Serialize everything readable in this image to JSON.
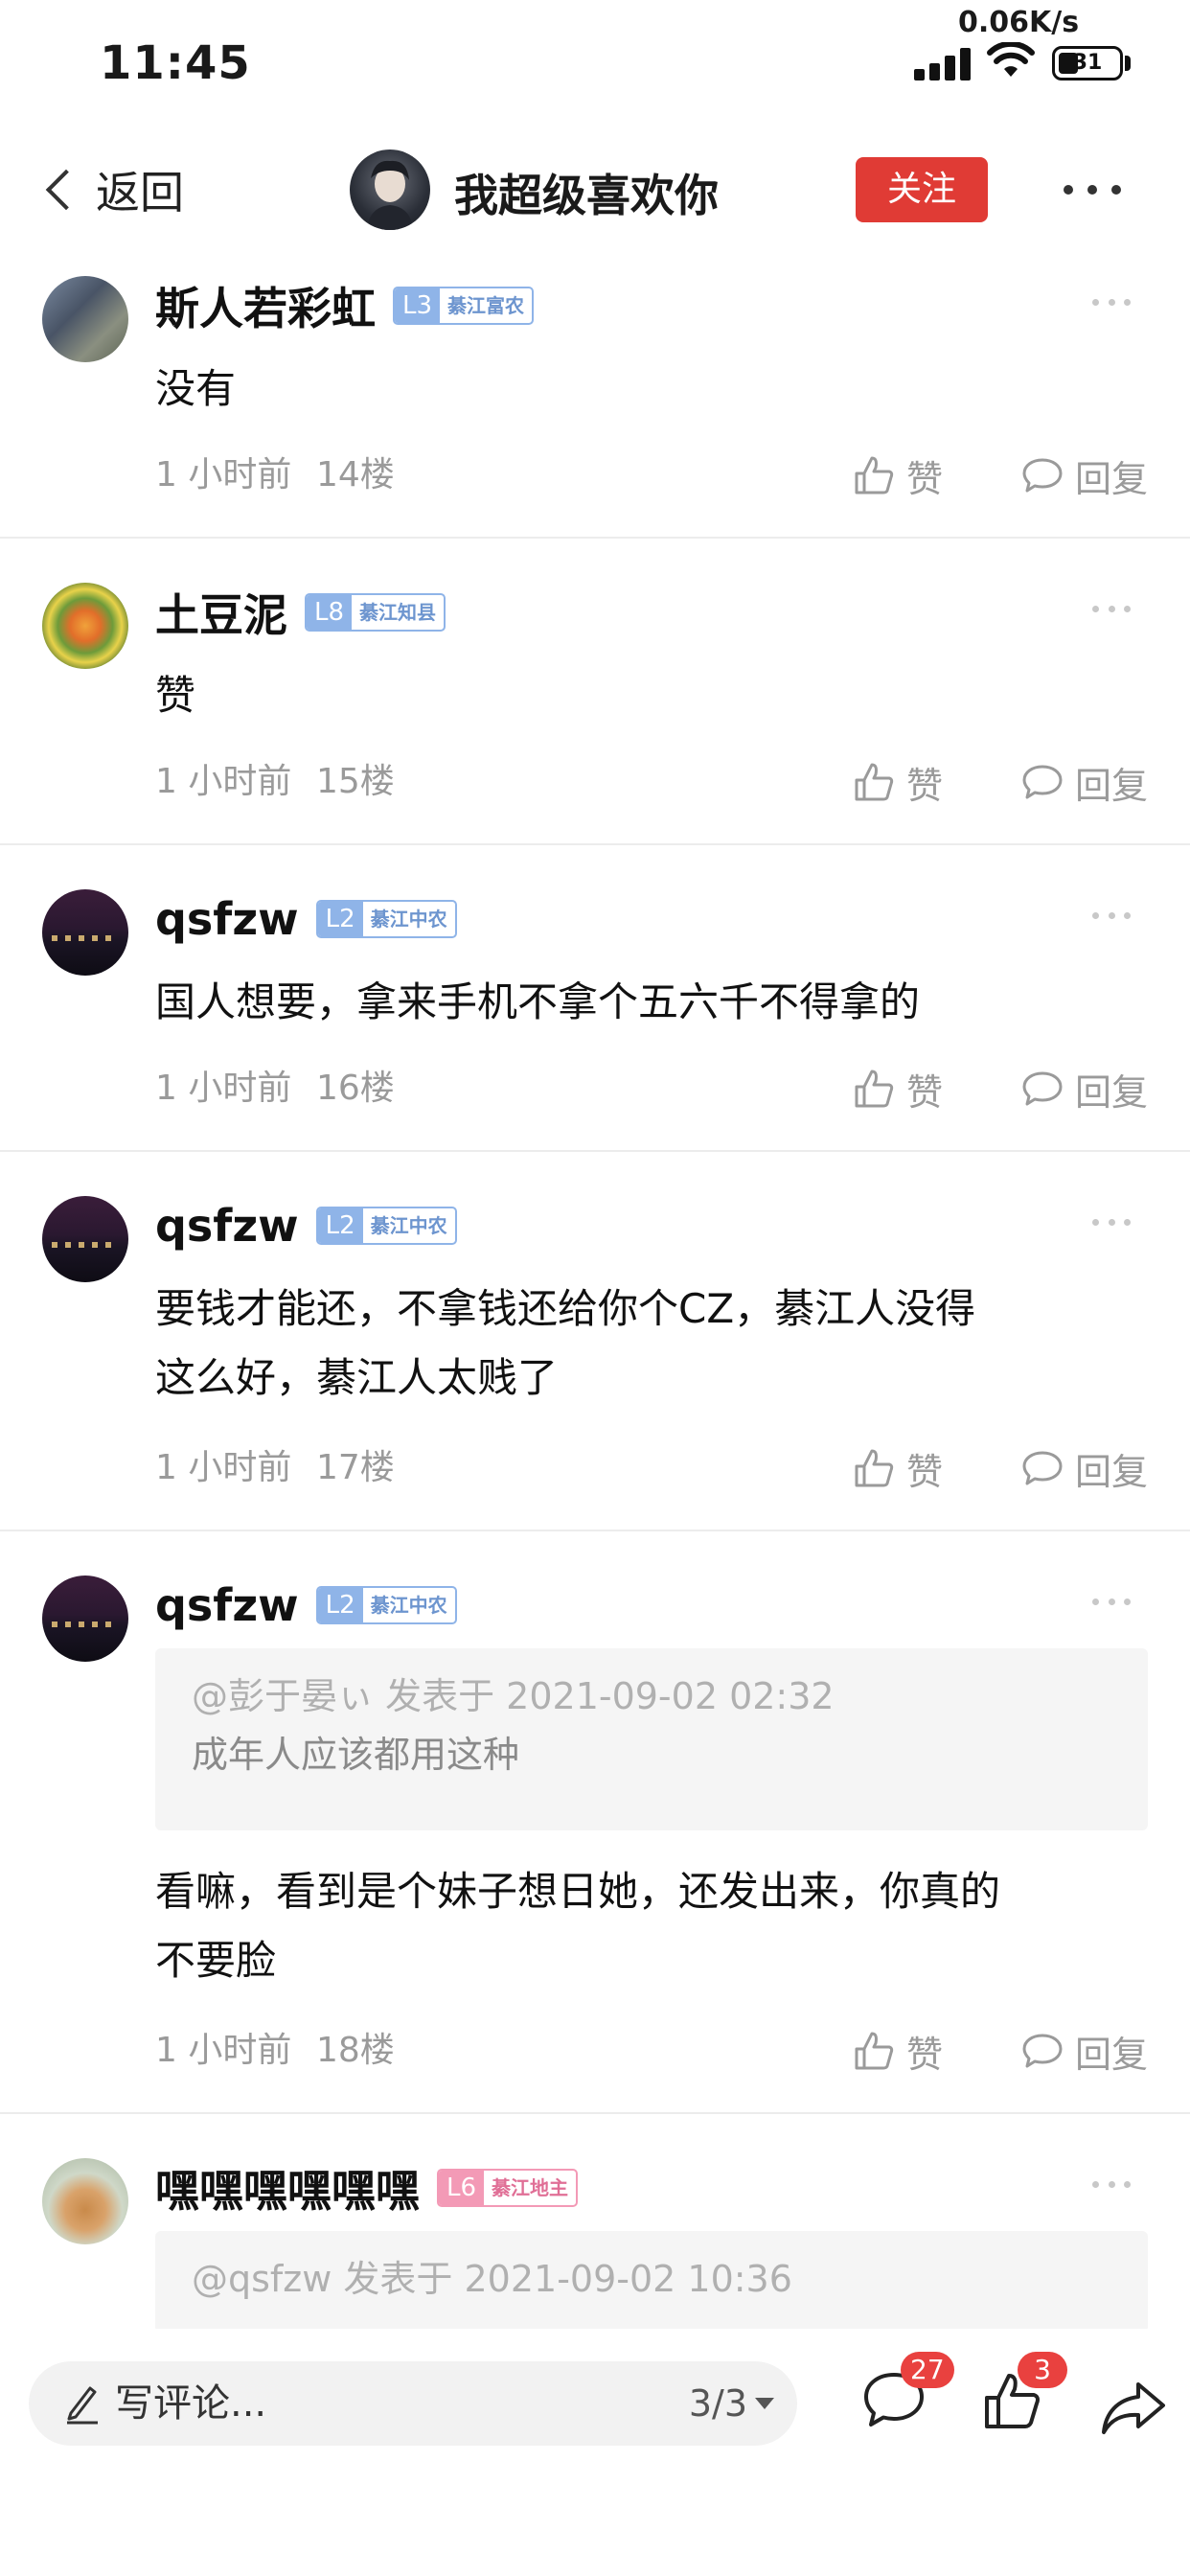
{
  "status_bar": {
    "time": "11:45",
    "net_speed": "0.06K/s",
    "battery": "31"
  },
  "nav": {
    "back_label": "返回",
    "title": "我超级喜欢你",
    "follow_label": "关注"
  },
  "comments": [
    {
      "username": "斯人若彩虹",
      "level": "L3",
      "title": "綦江富农",
      "content": "没有",
      "time": "1 小时前",
      "floor": "14楼",
      "like_label": "赞",
      "reply_label": "回复"
    },
    {
      "username": "土豆泥",
      "level": "L8",
      "title": "綦江知县",
      "content": "赞",
      "time": "1 小时前",
      "floor": "15楼",
      "like_label": "赞",
      "reply_label": "回复"
    },
    {
      "username": "qsfzw",
      "level": "L2",
      "title": "綦江中农",
      "content": "国人想要，拿来手机不拿个五六千不得拿的",
      "time": "1 小时前",
      "floor": "16楼",
      "like_label": "赞",
      "reply_label": "回复"
    },
    {
      "username": "qsfzw",
      "level": "L2",
      "title": "綦江中农",
      "content_line1": "要钱才能还，不拿钱还给你个CZ，綦江人没得",
      "content_line2": "这么好，綦江人太贱了",
      "time": "1 小时前",
      "floor": "17楼",
      "like_label": "赞",
      "reply_label": "回复"
    },
    {
      "username": "qsfzw",
      "level": "L2",
      "title": "綦江中农",
      "quote_head": "@彭于晏ぃ 发表于 2021-09-02 02:32",
      "quote_body": "成年人应该都用这种",
      "content_line1": "看嘛，看到是个妹子想日她，还发出来，你真的",
      "content_line2": "不要脸",
      "time": "1 小时前",
      "floor": "18楼",
      "like_label": "赞",
      "reply_label": "回复"
    },
    {
      "username": "嘿嘿嘿嘿嘿嘿",
      "level": "L6",
      "title": "綦江地主",
      "quote_head": "@qsfzw 发表于 2021-09-02 10:36"
    }
  ],
  "bottom_bar": {
    "placeholder": "写评论...",
    "page": "3/3",
    "comment_count": "27",
    "like_count": "3"
  },
  "icons": {
    "back": "chevron-left-icon",
    "more": "more-horizontal-icon",
    "like": "thumbs-up-icon",
    "reply": "speech-bubble-icon",
    "pen": "pen-icon",
    "share": "share-arrow-icon"
  },
  "colors": {
    "follow": "#e03b35",
    "badge_blue": "#8fb4e8",
    "badge_pink": "#f39ab6",
    "count_badge": "#e9413f"
  }
}
